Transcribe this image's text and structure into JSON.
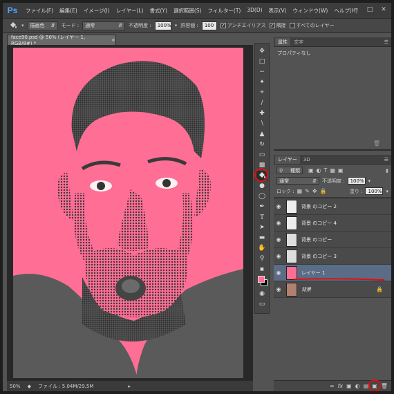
{
  "app": {
    "logo": "Ps",
    "menu": [
      "ファイル(F)",
      "編集(E)",
      "イメージ(I)",
      "レイヤー(L)",
      "書式(Y)",
      "選択範囲(S)",
      "フィルター(T)",
      "3D(D)",
      "表示(V)",
      "ウィンドウ(W)",
      "ヘルプ(H)"
    ]
  },
  "options_bar": {
    "fill_source": "描画色",
    "mode_label": "モード :",
    "mode_value": "通常",
    "opacity_label": "不透明度 :",
    "opacity_value": "100%",
    "tolerance_label": "許容値 :",
    "tolerance_value": "100",
    "antialias_label": "アンチエイリアス",
    "contiguous_label": "隣接",
    "all_layers_label": "すべてのレイヤー"
  },
  "document": {
    "tab_title": "face90.psd @ 50% (レイヤー 1, RGB/8#) *",
    "close_glyph": "×",
    "canvas_color": "#ff6e94"
  },
  "status_bar": {
    "zoom": "50%",
    "file_info": "ファイル : 5.04M/29.5M"
  },
  "tools": {
    "foreground_color": "#ff6e94",
    "background_color": "#000000",
    "active_tool": "paint-bucket-icon"
  },
  "properties_panel": {
    "tabs": [
      "属性",
      "文字"
    ],
    "body": "プロパティなし"
  },
  "layers_panel": {
    "tabs": [
      "レイヤー",
      "3D"
    ],
    "filter_kind": "種類",
    "blend_mode": "通常",
    "opacity_label": "不透明度 :",
    "opacity_value": "100%",
    "lock_label": "ロック :",
    "fill_label": "塗り :",
    "fill_value": "100%",
    "layers": [
      {
        "name": "背景 のコピー 2",
        "thumb": "sketch",
        "selected": false
      },
      {
        "name": "背景 のコピー 4",
        "thumb": "sketch",
        "selected": false
      },
      {
        "name": "背景 のコピー",
        "thumb": "face",
        "selected": false
      },
      {
        "name": "背景 のコピー 3",
        "thumb": "face",
        "selected": false
      },
      {
        "name": "レイヤー 1",
        "thumb": "pink",
        "selected": true
      },
      {
        "name": "背景",
        "thumb": "photo",
        "selected": false,
        "locked": true
      }
    ]
  },
  "annotation_color": "#e01010"
}
